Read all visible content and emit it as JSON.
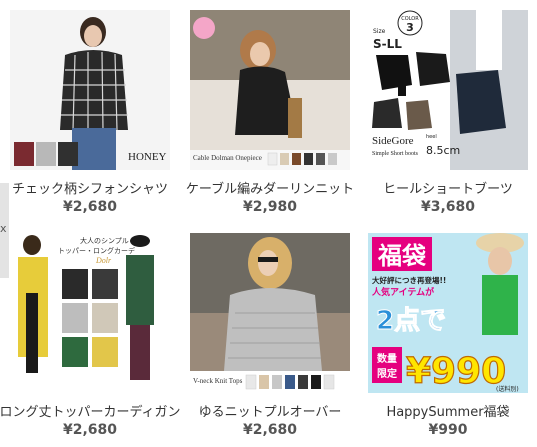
{
  "products": [
    {
      "name": "チェック柄シフォンシャツ",
      "price": "¥2,680",
      "overlay_text": "HONEY"
    },
    {
      "name": "ケーブル編みダーリンニット",
      "price": "¥2,980",
      "overlay_text": "Cable Dolman Onepiece"
    },
    {
      "name": "ヒールショートブーツ",
      "price": "¥3,680",
      "overlay_texts": {
        "color_badge_top": "COLOR",
        "color_badge_num": "3",
        "size_label": "Size",
        "size_value": "S-LL",
        "title_line1": "SideGore",
        "title_line2": "Simple Short boots",
        "heel_label": "heel",
        "heel_value": "8.5cm"
      }
    },
    {
      "name": "ロング丈トッパーカーディガン",
      "price": "¥2,680",
      "overlay_texts": {
        "headline1": "大人のシンプル",
        "headline2": "トッパー・ロングカーデ",
        "accent": "Dolr"
      }
    },
    {
      "name": "ゆるニットプルオーバー",
      "price": "¥2,680",
      "overlay_text": "V-neck Knit Tops"
    },
    {
      "name": "HappySummer福袋",
      "price": "¥990",
      "overlay_texts": {
        "banner": "福袋",
        "sub1": "大好評につき再登場!!",
        "sub2": "人気アイテムが",
        "big": "2点で",
        "limited1": "数量",
        "limited2": "限定",
        "sale_price": "¥990",
        "tax": "(送料別)"
      }
    }
  ],
  "side_tab_glyph": "x",
  "colors": {
    "name_text": "#333333",
    "price_text": "#555555",
    "banner_red": "#e5007f",
    "banner_yellow": "#ffe600",
    "banner_green": "#2fb34a"
  }
}
